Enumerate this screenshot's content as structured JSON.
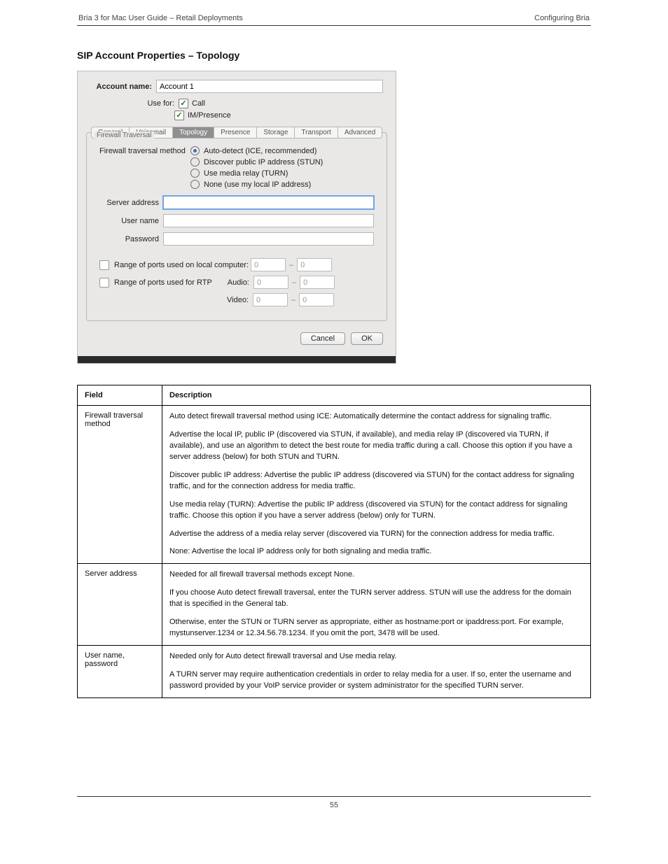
{
  "header": {
    "product": "Bria 3 for Mac User Guide – Retail Deployments",
    "section": "Configuring Bria"
  },
  "sectionTitle": "SIP Account Properties – Topology",
  "dialog": {
    "accountNameLabel": "Account name:",
    "accountName": "Account 1",
    "useForLabel": "Use for:",
    "chkCall": "Call",
    "chkIM": "IM/Presence",
    "tabs": [
      "General",
      "Voicemail",
      "Topology",
      "Presence",
      "Storage",
      "Transport",
      "Advanced"
    ],
    "activeTab": 2,
    "fieldsetCaption": "Firewall Traversal",
    "methodLabel": "Firewall traversal method",
    "radios": [
      "Auto-detect (ICE, recommended)",
      "Discover public IP address (STUN)",
      "Use media relay (TURN)",
      "None (use my local IP address)"
    ],
    "serverAddressLabel": "Server address",
    "userNameLabel": "User name",
    "passwordLabel": "Password",
    "portsLocalLabel": "Range of ports used on local computer:",
    "portsRtpLabel": "Range of ports used for RTP",
    "audioLabel": "Audio:",
    "videoLabel": "Video:",
    "zero": "0",
    "cancel": "Cancel",
    "ok": "OK"
  },
  "table": {
    "head": {
      "field": "Field",
      "desc": "Description"
    },
    "rows": [
      {
        "field": "Firewall traversal method",
        "paras": [
          "Auto detect firewall traversal method using ICE: Automatically determine the contact address for signaling traffic.",
          "Advertise the local IP, public IP (discovered via STUN, if available), and media relay IP (discovered via TURN, if available), and use an algorithm to detect the best route for media traffic during a call. Choose this option if you have a server address (below) for both STUN and TURN.",
          "Discover public IP address: Advertise the public IP address (discovered via STUN) for the contact address for signaling traffic, and for the connection address for media traffic.",
          "Use media relay (TURN): Advertise the public IP address (discovered via STUN) for the contact address for signaling traffic. Choose this option if you have a server address (below) only for TURN.",
          "Advertise the address of a media relay server (discovered via TURN) for the connection address for media traffic.",
          "None: Advertise the local IP address only for both signaling and media traffic."
        ]
      },
      {
        "field": "Server address",
        "paras": [
          "Needed for all firewall traversal methods except None.",
          "If you choose Auto detect firewall traversal, enter the TURN server address. STUN will use the address for the domain that is specified in the General tab.",
          "Otherwise, enter the STUN or TURN server as appropriate, either as hostname:port or ipaddress:port. For example, mystunserver.1234 or 12.34.56.78.1234. If you omit the port, 3478 will be used."
        ]
      },
      {
        "field": "User name, password",
        "paras": [
          "Needed only for Auto detect firewall traversal and Use media relay.",
          "A TURN server may require authentication credentials in order to relay media for a user. If so, enter the username and password provided by your VoIP service provider or system administrator for the specified TURN server."
        ]
      }
    ]
  },
  "footer": {
    "page": "55"
  }
}
